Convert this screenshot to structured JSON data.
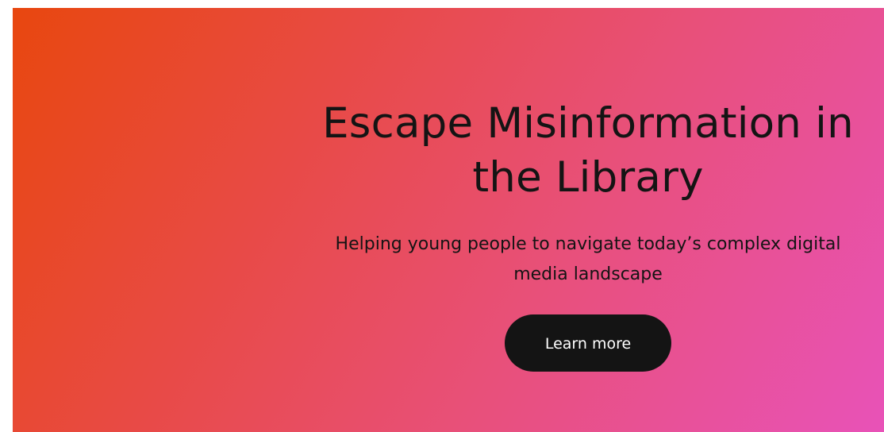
{
  "hero": {
    "headline_line1": "Escape Misinformation in",
    "headline_line2": "the Library",
    "subhead_line1": "Helping young people to navigate today’s complex digital",
    "subhead_line2": "media landscape",
    "cta_label": "Learn more"
  },
  "colors": {
    "gradient_start": "#e8470f",
    "gradient_end": "#e852b8",
    "text": "#141414",
    "button_bg": "#141414",
    "button_text": "#ffffff"
  }
}
